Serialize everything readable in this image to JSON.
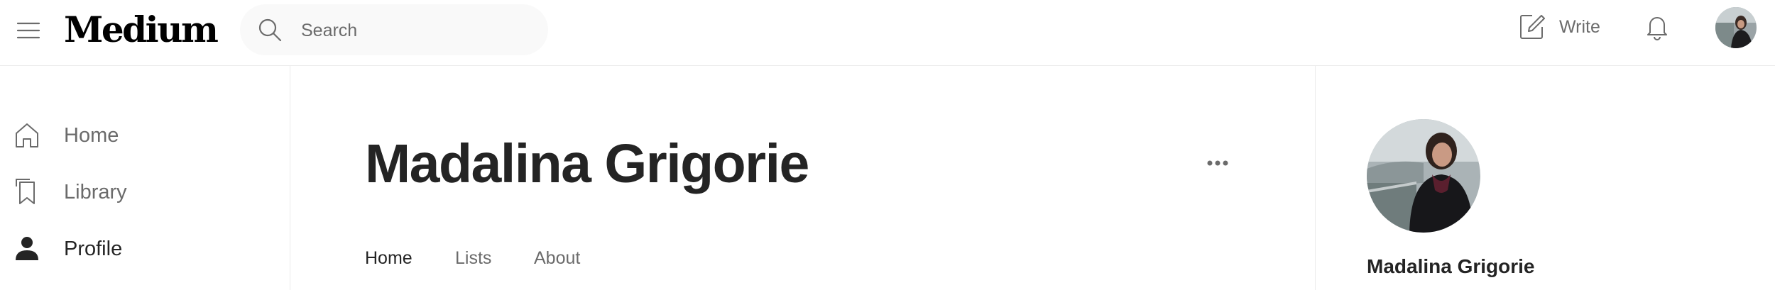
{
  "topbar": {
    "logo": "Medium",
    "search_placeholder": "Search",
    "write_label": "Write"
  },
  "sidebar": {
    "items": [
      {
        "label": "Home",
        "icon": "home-icon"
      },
      {
        "label": "Library",
        "icon": "bookmark-icon"
      },
      {
        "label": "Profile",
        "icon": "person-icon"
      }
    ],
    "active": "Profile"
  },
  "profile": {
    "name": "Madalina Grigorie",
    "tabs": [
      "Home",
      "Lists",
      "About"
    ],
    "active_tab": "Home"
  },
  "right_sidebar": {
    "name": "Madalina Grigorie"
  }
}
